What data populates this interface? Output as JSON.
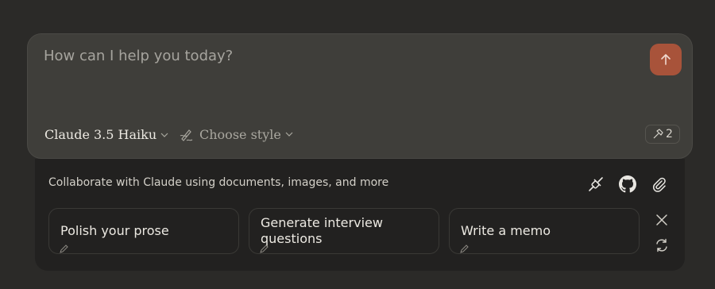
{
  "composer": {
    "placeholder": "How can I help you today?",
    "model_label": "Claude 3.5 Haiku",
    "style_label": "Choose style",
    "tools_count": "2"
  },
  "panel": {
    "collab_text": "Collaborate with Claude using documents, images, and more",
    "cards": [
      {
        "label": "Polish your prose"
      },
      {
        "label": "Generate interview questions"
      },
      {
        "label": "Write a memo"
      }
    ]
  },
  "icons": {
    "send": "arrow-up-icon",
    "style": "pen-writing-icon",
    "tools": "hammer-icon",
    "integrations": "plug-icon",
    "github": "github-icon",
    "attach": "paperclip-icon",
    "close": "close-icon",
    "refresh": "refresh-icon"
  },
  "colors": {
    "background": "#2b2a28",
    "composer": "#3f3e3a",
    "panel": "#222120",
    "send_button": "#a8533a"
  }
}
